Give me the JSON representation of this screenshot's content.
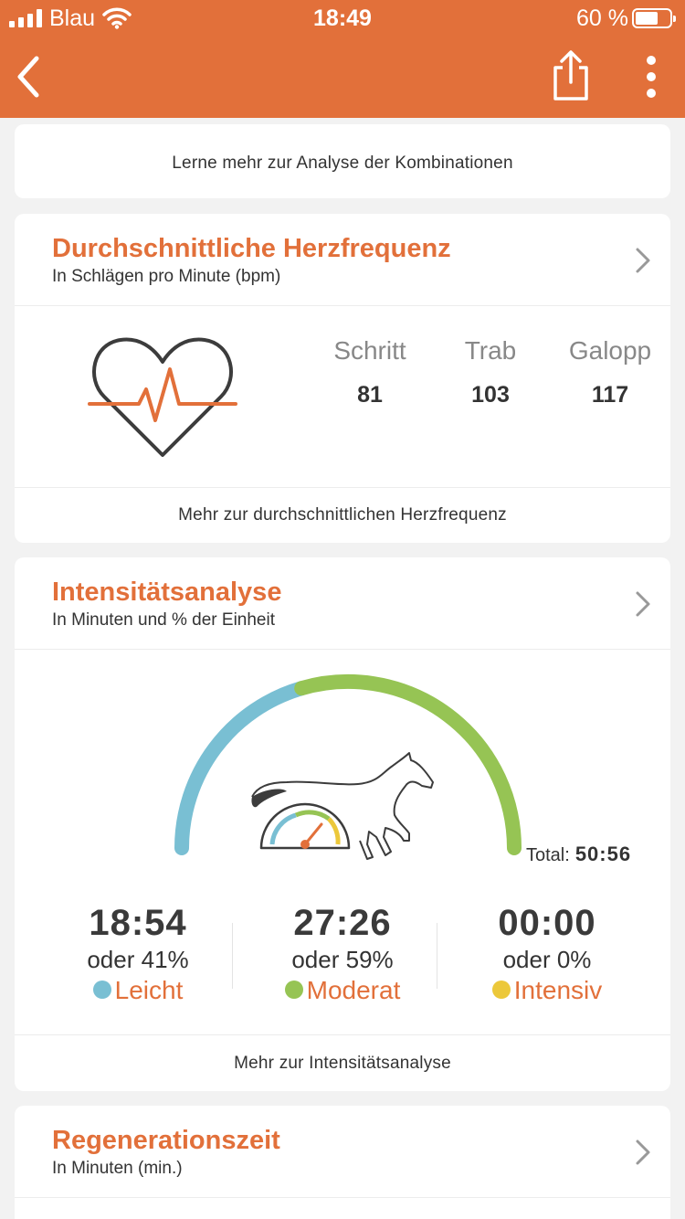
{
  "status_bar": {
    "carrier": "Blau",
    "time": "18:49",
    "battery": "60 %"
  },
  "colors": {
    "accent": "#e2703a",
    "leicht": "#79bfd3",
    "moderat": "#96c454",
    "intensiv": "#ecc83a"
  },
  "navbar": {
    "back_icon": "chevron-left-icon",
    "share_icon": "share-icon",
    "more_icon": "more-vertical-icon"
  },
  "top_card": {
    "link": "Lerne mehr zur Analyse der Kombinationen"
  },
  "heart_card": {
    "title": "Durchschnittliche Herzfrequenz",
    "subtitle": "In Schlägen pro Minute (bpm)",
    "gaits": [
      {
        "label": "Schritt",
        "value": "81"
      },
      {
        "label": "Trab",
        "value": "103"
      },
      {
        "label": "Galopp",
        "value": "117"
      }
    ],
    "link": "Mehr zur durchschnittlichen Herzfrequenz"
  },
  "intensity_card": {
    "title": "Intensitätsanalyse",
    "subtitle": "In Minuten und % der Einheit",
    "total_label": "Total:",
    "total_value": "50:56",
    "gauge_fractions": {
      "leicht": 0.41,
      "moderat": 0.59,
      "intensiv": 0.0
    },
    "stats": [
      {
        "time": "18:54",
        "percent": "oder 41%",
        "category": "Leicht"
      },
      {
        "time": "27:26",
        "percent": "oder 59%",
        "category": "Moderat"
      },
      {
        "time": "00:00",
        "percent": "oder 0%",
        "category": "Intensiv"
      }
    ],
    "link": "Mehr zur Intensitätsanalyse"
  },
  "regen_card": {
    "title": "Regenerationszeit",
    "subtitle": "In Minuten (min.)"
  }
}
